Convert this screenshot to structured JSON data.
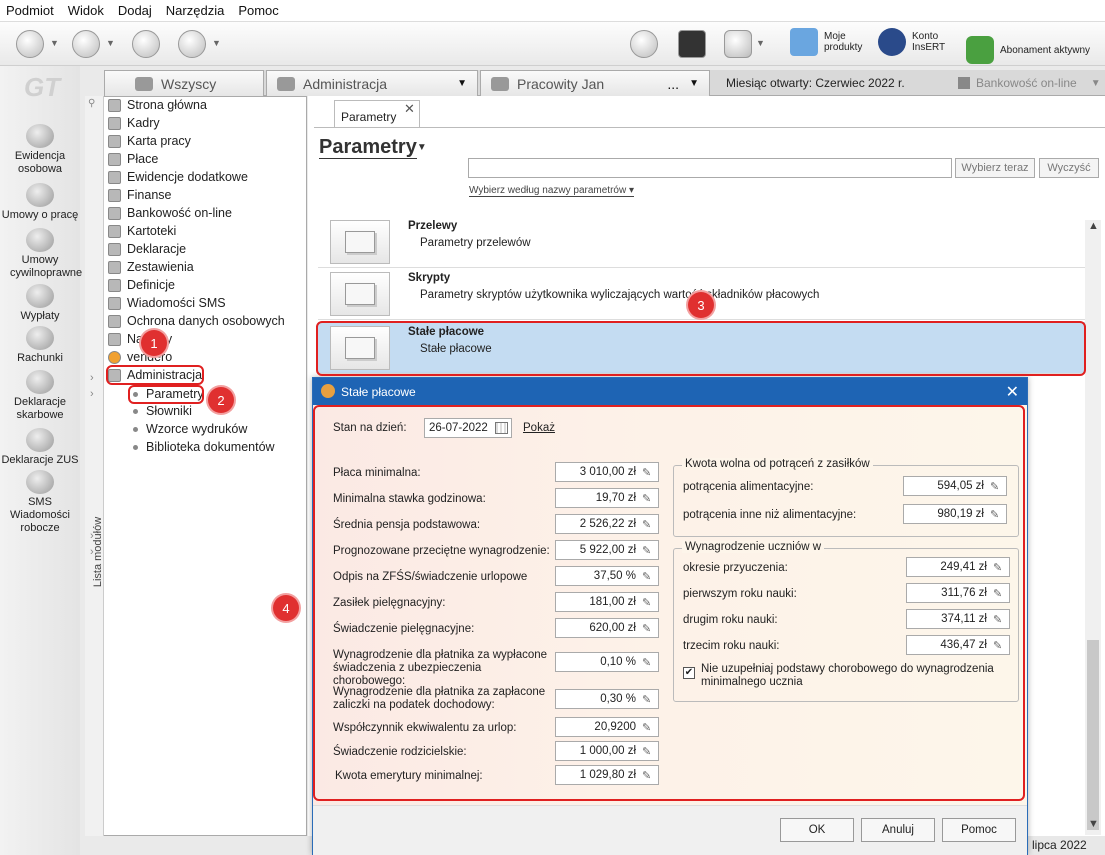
{
  "menu": [
    "Podmiot",
    "Widok",
    "Dodaj",
    "Narzędzia",
    "Pomoc"
  ],
  "toolbar": {
    "moje_produkty": "Moje produkty",
    "konto": "Konto InsERT",
    "abonament": "Abonament aktywny"
  },
  "left_icons": [
    "Ewidencja osobowa",
    "Umowy o pracę",
    "Umowy cywilnoprawne",
    "Wypłaty",
    "Rachunki",
    "Deklaracje skarbowe",
    "Deklaracje ZUS",
    "SMS Wiadomości robocze"
  ],
  "context": {
    "tab1": "Wszyscy",
    "tab2": "Administracja",
    "tab3": "Pracowity Jan",
    "tab3_extra": "...",
    "month": "Miesiąc otwarty: Czerwiec 2022 r.",
    "bank": "Bankowość on-line"
  },
  "module_list_label": "Lista modułów",
  "tree": [
    "Strona główna",
    "Kadry",
    "Karta pracy",
    "Płace",
    "Ewidencje dodatkowe",
    "Finanse",
    "Bankowość on-line",
    "Kartoteki",
    "Deklaracje",
    "Zestawienia",
    "Definicje",
    "Wiadomości SMS",
    "Ochrona danych osobowych",
    "Nakłady",
    "vendero",
    "Administracja"
  ],
  "tree_sub": [
    "Parametry",
    "Słowniki",
    "Wzorce wydruków",
    "Biblioteka dokumentów"
  ],
  "page": {
    "tab_label": "Parametry",
    "title": "Parametry",
    "choose": "Wybierz teraz",
    "clear": "Wyczyść",
    "filter": "Wybierz według nazwy parametrów"
  },
  "rows": [
    {
      "title": "Przelewy",
      "desc": "Parametry przelewów"
    },
    {
      "title": "Skrypty",
      "desc": "Parametry skryptów użytkownika wyliczających wartość składników płacowych"
    },
    {
      "title": "Stałe płacowe",
      "desc": "Stałe płacowe"
    }
  ],
  "dialog": {
    "title": "Stałe płacowe",
    "date_label": "Stan na dzień:",
    "date": "26-07-2022",
    "show": "Pokaż",
    "fields": [
      {
        "label": "Płaca minimalna:",
        "value": "3 010,00 zł"
      },
      {
        "label": "Minimalna stawka godzinowa:",
        "value": "19,70 zł"
      },
      {
        "label": "Średnia pensja podstawowa:",
        "value": "2 526,22 zł"
      },
      {
        "label": "Prognozowane przeciętne wynagrodzenie:",
        "value": "5 922,00 zł"
      },
      {
        "label": "Odpis na ZFŚS/świadczenie urlopowe",
        "value": "37,50 %"
      },
      {
        "label": "Zasiłek pielęgnacyjny:",
        "value": "181,00 zł"
      },
      {
        "label": "Świadczenie pielęgnacyjne:",
        "value": "620,00 zł"
      },
      {
        "label": "Wynagrodzenie dla płatnika za wypłacone świadczenia z ubezpieczenia chorobowego:",
        "value": "0,10 %"
      },
      {
        "label": "Wynagrodzenie dla płatnika za zapłacone zaliczki na podatek dochodowy:",
        "value": "0,30 %"
      },
      {
        "label": "Współczynnik ekwiwalentu za urlop:",
        "value": "20,9200"
      },
      {
        "label": "Świadczenie rodzicielskie:",
        "value": "1 000,00 zł"
      },
      {
        "label": "Kwota emerytury minimalnej:",
        "value": "1 029,80 zł"
      }
    ],
    "group1": {
      "title": "Kwota wolna od potrąceń z zasiłków",
      "items": [
        {
          "label": "potrącenia alimentacyjne:",
          "value": "594,05 zł"
        },
        {
          "label": "potrącenia inne niż alimentacyjne:",
          "value": "980,19 zł"
        }
      ]
    },
    "group2": {
      "title": "Wynagrodzenie uczniów w",
      "items": [
        {
          "label": "okresie przyuczenia:",
          "value": "249,41 zł"
        },
        {
          "label": "pierwszym roku nauki:",
          "value": "311,76 zł"
        },
        {
          "label": "drugim roku nauki:",
          "value": "374,11 zł"
        },
        {
          "label": "trzecim roku nauki:",
          "value": "436,47 zł"
        }
      ],
      "checkbox": "Nie uzupełniaj podstawy chorobowego do wynagrodzenia minimalnego ucznia"
    },
    "ok": "OK",
    "cancel": "Anuluj",
    "help": "Pomoc"
  },
  "status_date": "lipca 2022",
  "badges": [
    "1",
    "2",
    "3",
    "4"
  ]
}
